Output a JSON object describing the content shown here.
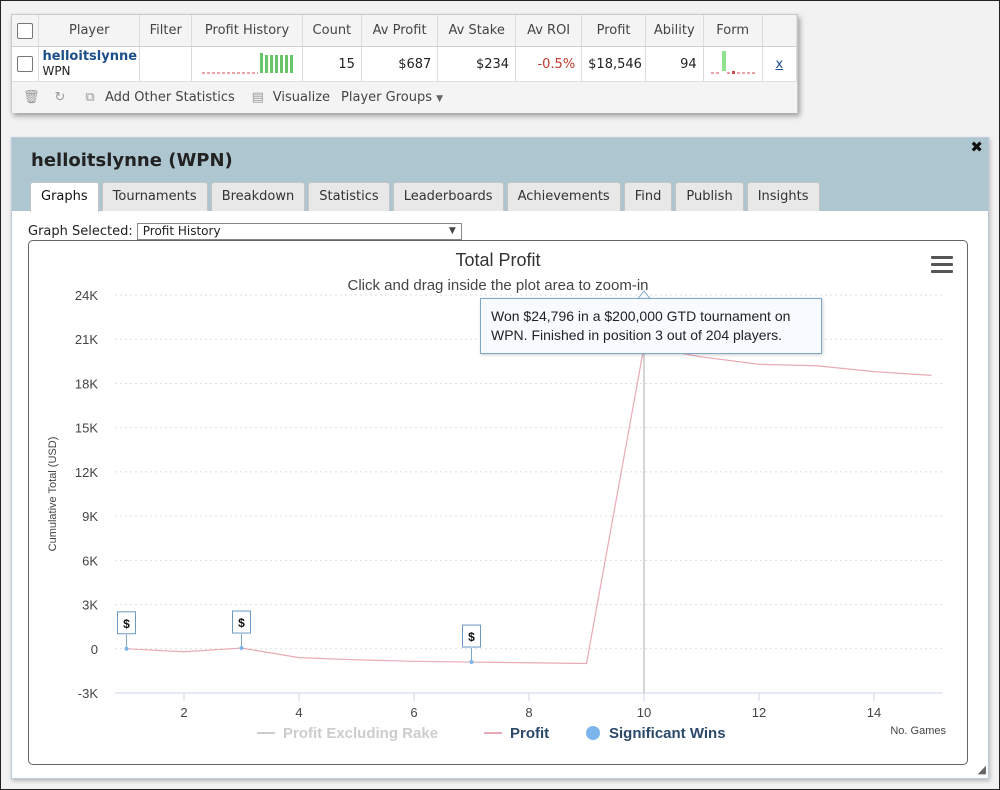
{
  "stats_table": {
    "headers": [
      "Player",
      "Filter",
      "Profit History",
      "Count",
      "Av Profit",
      "Av Stake",
      "Av ROI",
      "Profit",
      "Ability",
      "Form"
    ],
    "row": {
      "player_name": "helloitslynne",
      "network": "WPN",
      "filter": "",
      "count": "15",
      "av_profit": "$687",
      "av_stake": "$234",
      "av_roi": "-0.5%",
      "profit": "$18,546",
      "ability": "94",
      "remove_label": "x"
    },
    "toolbar": {
      "add_stats_label": "Add Other Statistics",
      "visualize_label": "Visualize",
      "player_groups_label": "Player Groups"
    }
  },
  "panel": {
    "title": "helloitslynne (WPN)",
    "tabs": [
      "Graphs",
      "Tournaments",
      "Breakdown",
      "Statistics",
      "Leaderboards",
      "Achievements",
      "Find",
      "Publish",
      "Insights"
    ],
    "active_tab": "Graphs",
    "graph_selector": {
      "label": "Graph Selected:",
      "value": "Profit History"
    }
  },
  "tooltip": {
    "text": "Won $24,796 in a $200,000 GTD tournament on WPN. Finished in position 3 out of 204 players."
  },
  "chart_data": {
    "type": "line",
    "title": "Total Profit",
    "subtitle": "Click and drag inside the plot area to zoom-in",
    "ylabel": "Cumulative Total (USD)",
    "xlabel": "No. Games",
    "xlim": [
      0.8,
      15.2
    ],
    "ylim": [
      -3000,
      24000
    ],
    "x_ticks": [
      2,
      4,
      6,
      8,
      10,
      12,
      14
    ],
    "y_ticks": [
      -3000,
      0,
      3000,
      6000,
      9000,
      12000,
      15000,
      18000,
      21000,
      24000
    ],
    "y_tick_labels": [
      "-3K",
      "0",
      "3K",
      "6K",
      "9K",
      "12K",
      "15K",
      "18K",
      "21K",
      "24K"
    ],
    "series": [
      {
        "name": "Profit Excluding Rake",
        "color": "#cccccc",
        "x": [],
        "y": []
      },
      {
        "name": "Profit",
        "color": "#e8aab4",
        "x": [
          1,
          2,
          3,
          4,
          5,
          6,
          7,
          8,
          9,
          10,
          11,
          12,
          13,
          14,
          15
        ],
        "y": [
          0,
          -200,
          50,
          -600,
          -750,
          -850,
          -900,
          -950,
          -1000,
          20500,
          19800,
          19300,
          19200,
          18800,
          18546
        ]
      }
    ],
    "significant_wins": {
      "name": "Significant Wins",
      "color": "#7cb5ec",
      "marker_label": "$",
      "x": [
        1,
        3,
        7
      ],
      "y": [
        0,
        50,
        -900
      ]
    },
    "hover_x": 10,
    "legend_position": "bottom-center",
    "grid": true
  }
}
